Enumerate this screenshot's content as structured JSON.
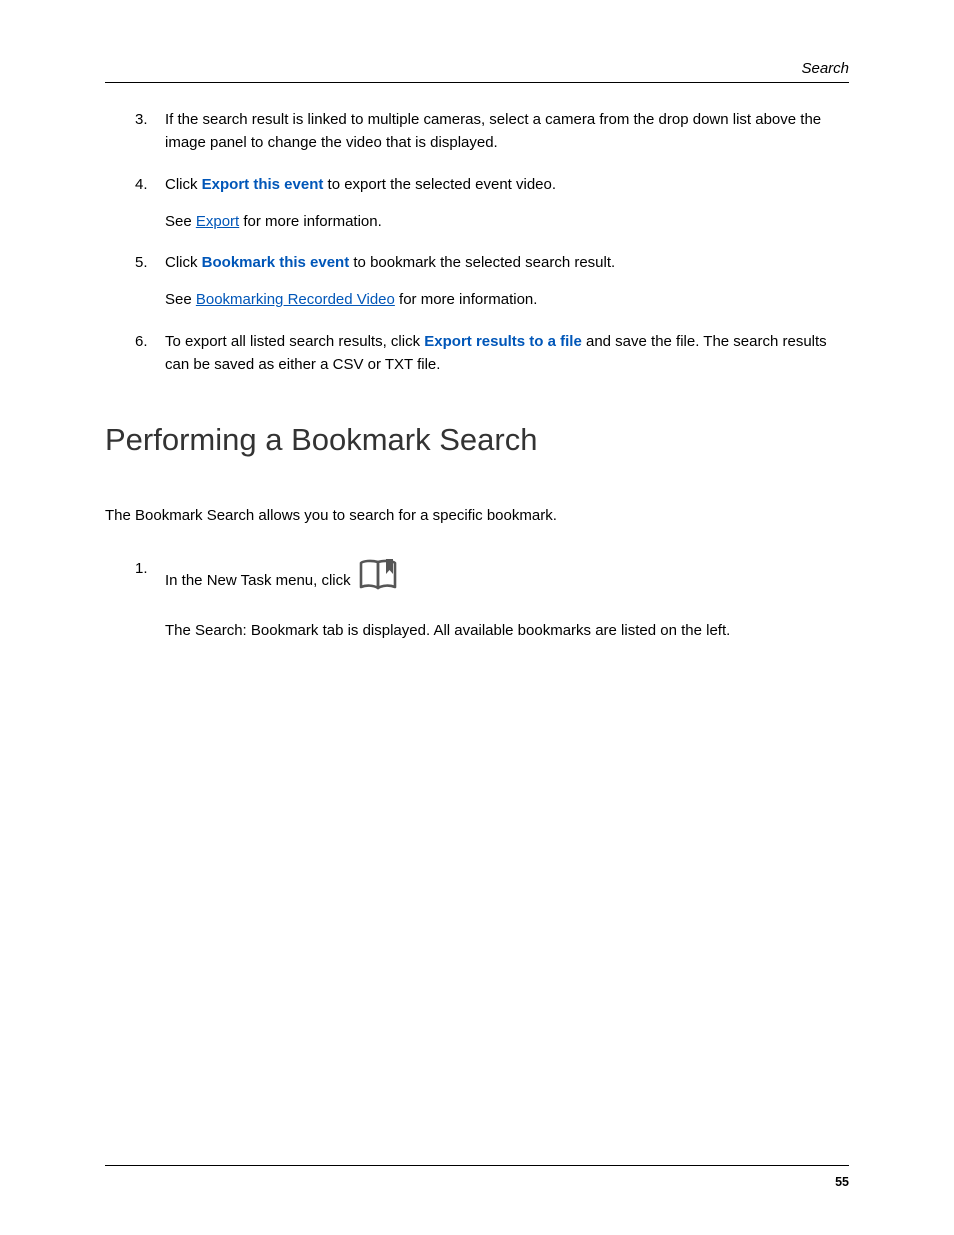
{
  "header": {
    "section": "Search"
  },
  "steps": {
    "s3": {
      "num": "3.",
      "text": "If the search result is linked to multiple cameras, select a camera from the drop down list above the image panel to change the video that is displayed."
    },
    "s4": {
      "num": "4.",
      "pre": "Click ",
      "bold": "Export this event",
      "post": " to export the selected event video.",
      "see_pre": "See ",
      "see_link": "Export",
      "see_post": " for more information."
    },
    "s5": {
      "num": "5.",
      "pre": "Click ",
      "bold": "Bookmark this event",
      "post": " to bookmark the selected search result.",
      "see_pre": "See ",
      "see_link": "Bookmarking Recorded Video",
      "see_post": " for more information."
    },
    "s6": {
      "num": "6.",
      "pre": "To export all listed search results, click ",
      "bold": "Export results to a file",
      "post": " and save the file. The search results can be saved as either a CSV or TXT file."
    }
  },
  "section": {
    "heading": "Performing a Bookmark Search",
    "intro": "The Bookmark Search allows you to search for a specific bookmark."
  },
  "section_steps": {
    "s1": {
      "num": "1.",
      "pre": "In the New Task menu, click ",
      "sub": "The Search: Bookmark tab is displayed. All available bookmarks are listed on the left."
    }
  },
  "footer": {
    "page": "55"
  }
}
